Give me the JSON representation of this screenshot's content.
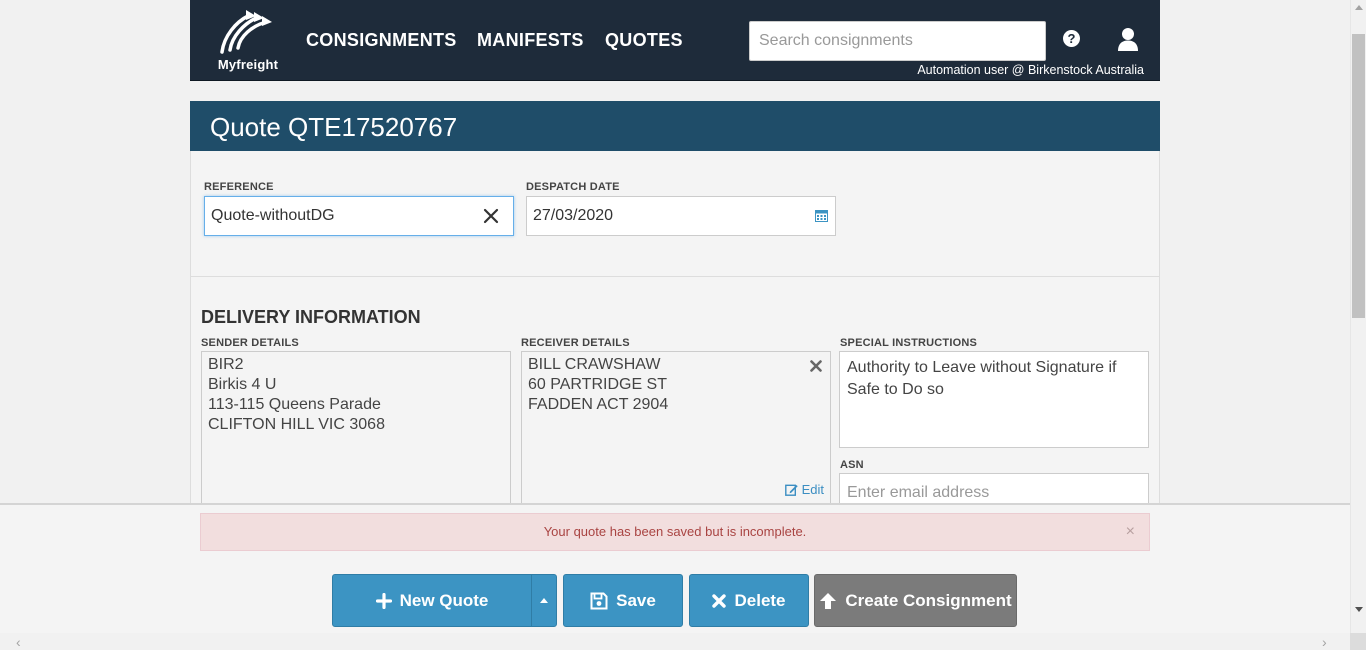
{
  "nav": {
    "logo_text": "Myfreight",
    "links": [
      "CONSIGNMENTS",
      "MANIFESTS",
      "QUOTES"
    ],
    "search_placeholder": "Search consignments",
    "help_symbol": "?",
    "user_line": "Automation user @ Birkenstock Australia"
  },
  "title": "Quote QTE17520767",
  "form": {
    "reference_label": "REFERENCE",
    "reference_value": "Quote-withoutDG",
    "despatch_label": "DESPATCH DATE",
    "despatch_value": "27/03/2020"
  },
  "delivery": {
    "heading": "DELIVERY INFORMATION",
    "sender_label": "SENDER DETAILS",
    "sender_lines": [
      "BIR2",
      "Birkis 4 U",
      "113-115 Queens Parade",
      "CLIFTON HILL VIC 3068"
    ],
    "receiver_label": "RECEIVER DETAILS",
    "receiver_lines": [
      "BILL CRAWSHAW",
      "60 PARTRIDGE ST",
      "FADDEN ACT 2904"
    ],
    "edit_label": "Edit",
    "special_label": "SPECIAL INSTRUCTIONS",
    "special_text": "Authority to Leave without Signature if Safe to Do so",
    "asn_label": "ASN",
    "asn_placeholder": "Enter email address"
  },
  "alert": {
    "message": "Your quote has been saved but is incomplete.",
    "close_symbol": "×"
  },
  "buttons": {
    "new_quote": "New Quote",
    "save": "Save",
    "delete": "Delete",
    "create": "Create Consignment"
  },
  "colors": {
    "nav_bg": "#1e2b3a",
    "title_bg": "#1f4d69",
    "primary_btn": "#3c94c3",
    "disabled_btn": "#7b7b7b",
    "alert_bg": "#f2dede",
    "alert_text": "#a94442"
  },
  "icons": {
    "logo": "myfreight-logo",
    "help": "question-circle-icon",
    "user": "user-icon",
    "clear": "close-icon",
    "calendar": "calendar-icon",
    "remove": "times-icon",
    "edit": "edit-icon",
    "new": "plus-icon",
    "caret": "caret-up-icon",
    "save": "save-icon",
    "delete": "times-icon",
    "create": "arrow-up-icon"
  }
}
